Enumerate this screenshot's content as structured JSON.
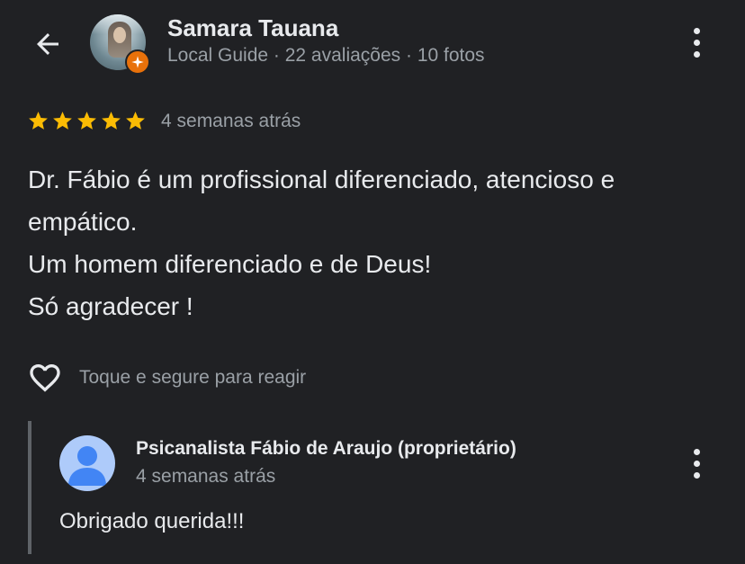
{
  "reviewer": {
    "name": "Samara Tauana",
    "meta": "Local Guide · 22 avaliações · 10 fotos",
    "avatar_icon": "user-photo",
    "badge_icon": "local-guide-star-icon"
  },
  "review": {
    "stars": 5,
    "max_stars": 5,
    "date": "4 semanas atrás",
    "lines": [
      "Dr. Fábio é um profissional diferenciado, atencioso e",
      "empático.",
      "Um homem diferenciado e de Deus!",
      "Só agradecer !"
    ]
  },
  "reaction": {
    "label": "Toque e segure para reagir",
    "icon": "heart-outline-icon"
  },
  "owner_reply": {
    "name": "Psicanalista Fábio de Araujo (proprietário)",
    "date": "4 semanas atrás",
    "text": "Obrigado querida!!!",
    "avatar_icon": "default-person-icon"
  },
  "colors": {
    "background": "#202124",
    "text_primary": "#e8eaed",
    "text_secondary": "#9aa0a6",
    "star": "#fbbc04",
    "badge": "#e8710a",
    "owner_avatar_bg": "#aecbfa",
    "owner_avatar_fg": "#4285f4"
  }
}
